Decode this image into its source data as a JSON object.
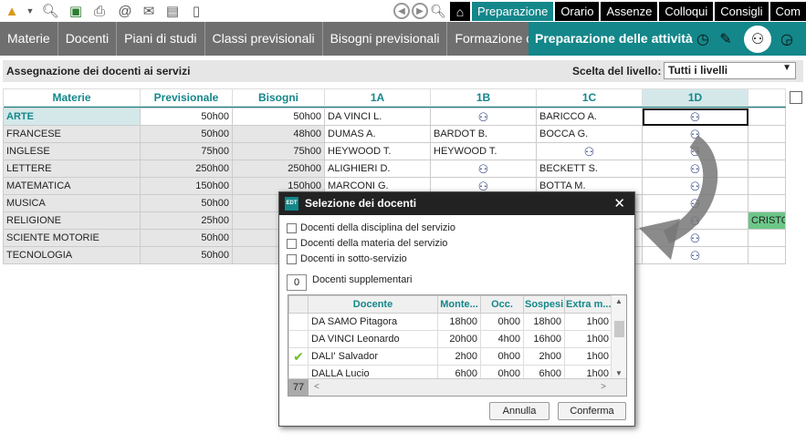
{
  "toolbar": {
    "icons": [
      "new-file-icon",
      "search-icon",
      "save-icon",
      "print-icon",
      "at-icon",
      "mail-icon",
      "document-icon",
      "phone-icon"
    ]
  },
  "top_tabs": [
    {
      "label": "Preparazione",
      "active": true
    },
    {
      "label": "Orario",
      "active": false
    },
    {
      "label": "Assenze",
      "active": false
    },
    {
      "label": "Colloqui",
      "active": false
    },
    {
      "label": "Consigli",
      "active": false
    },
    {
      "label": "Com",
      "active": false
    }
  ],
  "nav": {
    "items": [
      "Materie",
      "Docenti",
      "Piani di studi",
      "Classi previsionali",
      "Bisogni previsionali",
      "Formazione classi"
    ],
    "active": "Preparazione delle attività"
  },
  "panel": {
    "title": "Assegnazione dei docenti ai servizi",
    "level_label": "Scelta del livello:",
    "level_value": "Tutti i livelli"
  },
  "grid": {
    "headers": [
      "Materie",
      "Previsionale",
      "Bisogni",
      "1A",
      "1B",
      "1C",
      "1D",
      ""
    ],
    "rows": [
      {
        "subject": "ARTE",
        "prev": "50h00",
        "bis": "50h00",
        "c1A": "DA VINCI L.",
        "c1B": "@",
        "c1C": "BARICCO A.",
        "c1D": "@",
        "extra": ""
      },
      {
        "subject": "FRANCESE",
        "prev": "50h00",
        "bis": "48h00",
        "c1A": "DUMAS A.",
        "c1B": "BARDOT B.",
        "c1C": "BOCCA G.",
        "c1D": "@",
        "extra": ""
      },
      {
        "subject": "INGLESE",
        "prev": "75h00",
        "bis": "75h00",
        "c1A": "HEYWOOD T.",
        "c1B": "HEYWOOD T.",
        "c1C": "@",
        "c1D": "@",
        "extra": ""
      },
      {
        "subject": "LETTERE",
        "prev": "250h00",
        "bis": "250h00",
        "c1A": "ALIGHIERI D.",
        "c1B": "@",
        "c1C": "BECKETT S.",
        "c1D": "@",
        "extra": ""
      },
      {
        "subject": "MATEMATICA",
        "prev": "150h00",
        "bis": "150h00",
        "c1A": "MARCONI G.",
        "c1B": "@",
        "c1C": "BOTTA M.",
        "c1D": "@",
        "extra": ""
      },
      {
        "subject": "MUSICA",
        "prev": "50h00",
        "bis": "",
        "c1A": "",
        "c1B": "",
        "c1C": "",
        "c1D": "@",
        "extra": ""
      },
      {
        "subject": "RELIGIONE",
        "prev": "25h00",
        "bis": "",
        "c1A": "",
        "c1B": "",
        "c1C": "",
        "c1D": "@",
        "extra": "CRISTO"
      },
      {
        "subject": "SCIENTE MOTORIE",
        "prev": "50h00",
        "bis": "",
        "c1A": "",
        "c1B": "",
        "c1C": "",
        "c1D": "@",
        "extra": ""
      },
      {
        "subject": "TECNOLOGIA",
        "prev": "50h00",
        "bis": "",
        "c1A": "",
        "c1B": "",
        "c1C": "",
        "c1D": "@",
        "extra": ""
      }
    ]
  },
  "dialog": {
    "title": "Selezione dei docenti",
    "logo": "EDT",
    "checks": [
      "Docenti della disciplina del servizio",
      "Docenti della materia del servizio",
      "Docenti in sotto-servizio"
    ],
    "supp_value": "0",
    "supp_label": "Docenti supplementari",
    "columns": [
      "",
      "Docente",
      "Monte...",
      "Occ.",
      "Sospesi",
      "Extra m..."
    ],
    "rows": [
      {
        "check": "",
        "name": "DA SAMO Pitagora",
        "monte": "18h00",
        "occ": "0h00",
        "sosp": "18h00",
        "extra": "1h00"
      },
      {
        "check": "",
        "name": "DA VINCI Leonardo",
        "monte": "20h00",
        "occ": "4h00",
        "sosp": "16h00",
        "extra": "1h00"
      },
      {
        "check": "✔",
        "name": "DALI' Salvador",
        "monte": "2h00",
        "occ": "0h00",
        "sosp": "2h00",
        "extra": "1h00"
      },
      {
        "check": "",
        "name": "DALLA Lucio",
        "monte": "6h00",
        "occ": "0h00",
        "sosp": "6h00",
        "extra": "1h00"
      }
    ],
    "count": "77",
    "cancel": "Annulla",
    "confirm": "Conferma"
  }
}
